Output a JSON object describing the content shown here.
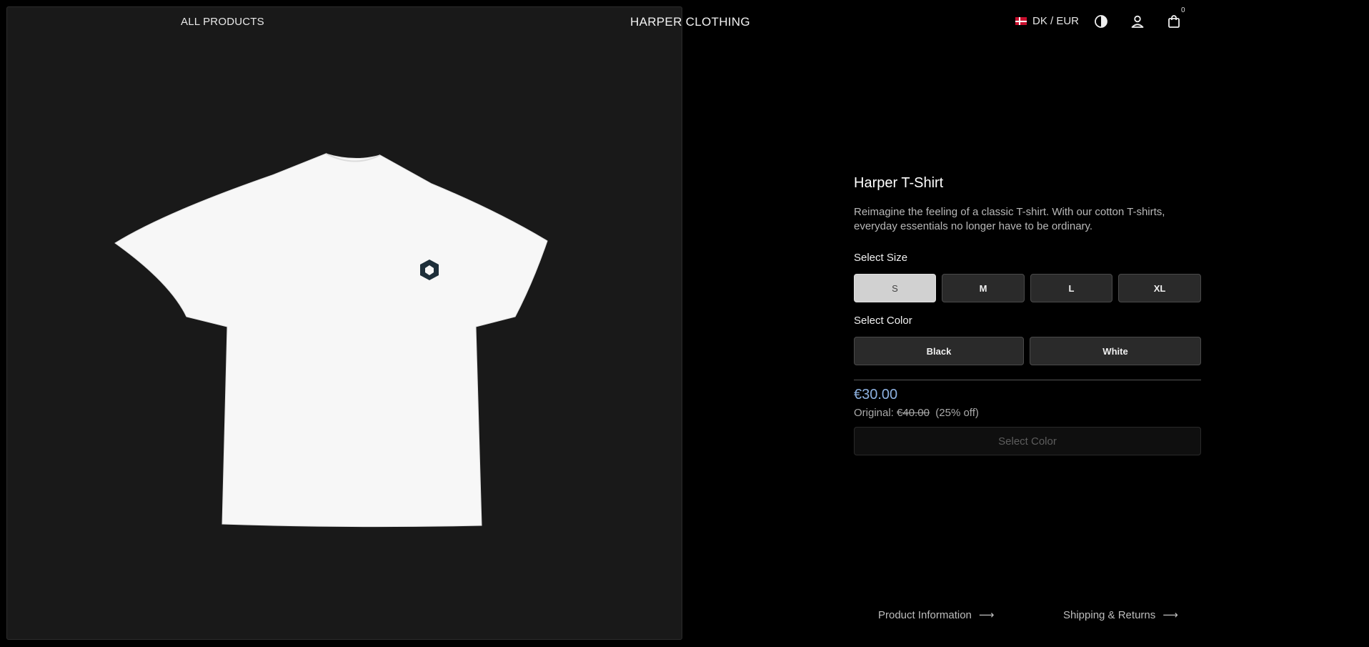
{
  "header": {
    "nav_link": "ALL PRODUCTS",
    "brand": "HARPER CLOTHING",
    "locale": "DK / EUR",
    "cart_count": "0"
  },
  "product": {
    "title": "Harper T-Shirt",
    "description": "Reimagine the feeling of a classic T-shirt. With our cotton T-shirts, everyday essentials no longer have to be ordinary.",
    "size_label": "Select Size",
    "sizes": [
      "S",
      "M",
      "L",
      "XL"
    ],
    "selected_size": "S",
    "color_label": "Select Color",
    "colors": [
      "Black",
      "White"
    ],
    "price": "€30.00",
    "original_label": "Original:",
    "original_price": "€40.00",
    "discount": "(25% off)",
    "cta_label": "Select Color"
  },
  "footer_links": {
    "product_info": "Product Information",
    "shipping": "Shipping & Returns",
    "arrow": "⟶"
  },
  "icons": [
    "flag-dk-icon",
    "contrast-icon",
    "user-icon",
    "shopping-bag-icon",
    "arrow-right-icon"
  ],
  "colors": {
    "background": "#000000",
    "panel": "#191919",
    "price_accent": "#8db1e0",
    "selected_option": "#d1d1d1"
  }
}
